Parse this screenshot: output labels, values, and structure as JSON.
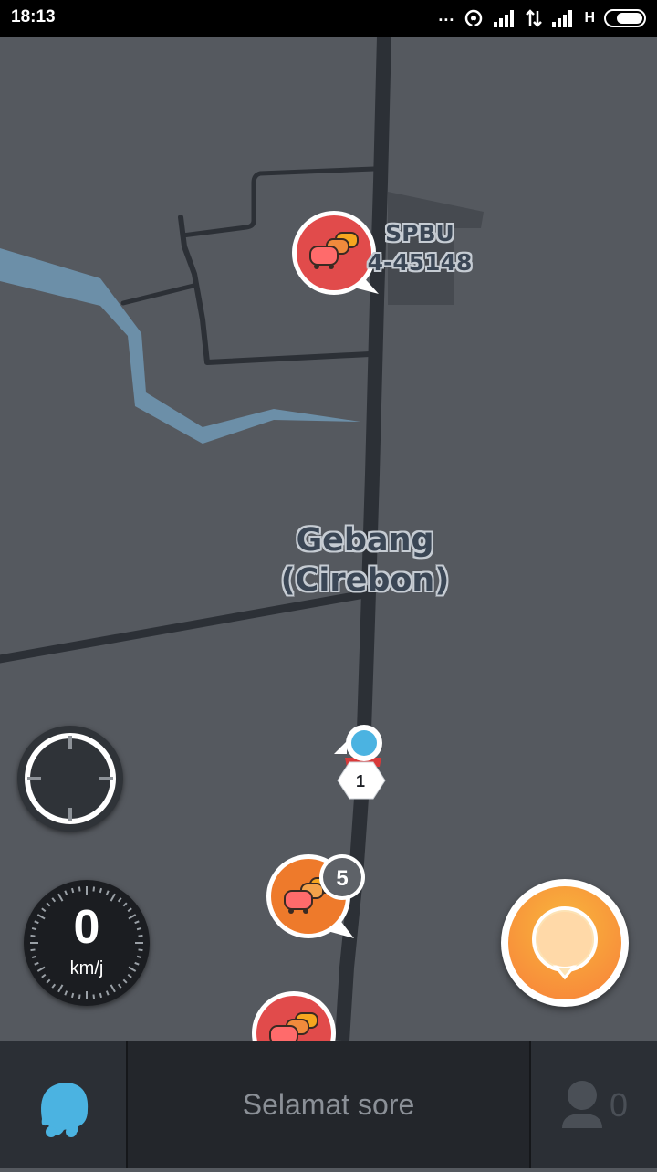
{
  "status_bar": {
    "time": "18:13",
    "dots": "...",
    "network_type": "H"
  },
  "map": {
    "poi_label_line1": "SPBU",
    "poi_label_line2": "4-45148",
    "place_label_line1": "Gebang",
    "place_label_line2": "(Cirebon)",
    "user_marker_number": "1",
    "traffic_cluster_count": "5",
    "colors": {
      "road": "#2c3036",
      "river": "#6c8fa8",
      "jam_red": "#e14b4b",
      "jam_orange": "#ee7a2b",
      "user_dot": "#4bb3e1"
    }
  },
  "speedometer": {
    "value": "0",
    "unit": "km/j"
  },
  "bottom_bar": {
    "greeting": "Selamat sore",
    "friends_count": "0",
    "left_icon": "waze-mood-icon",
    "right_icon": "person-icon"
  }
}
